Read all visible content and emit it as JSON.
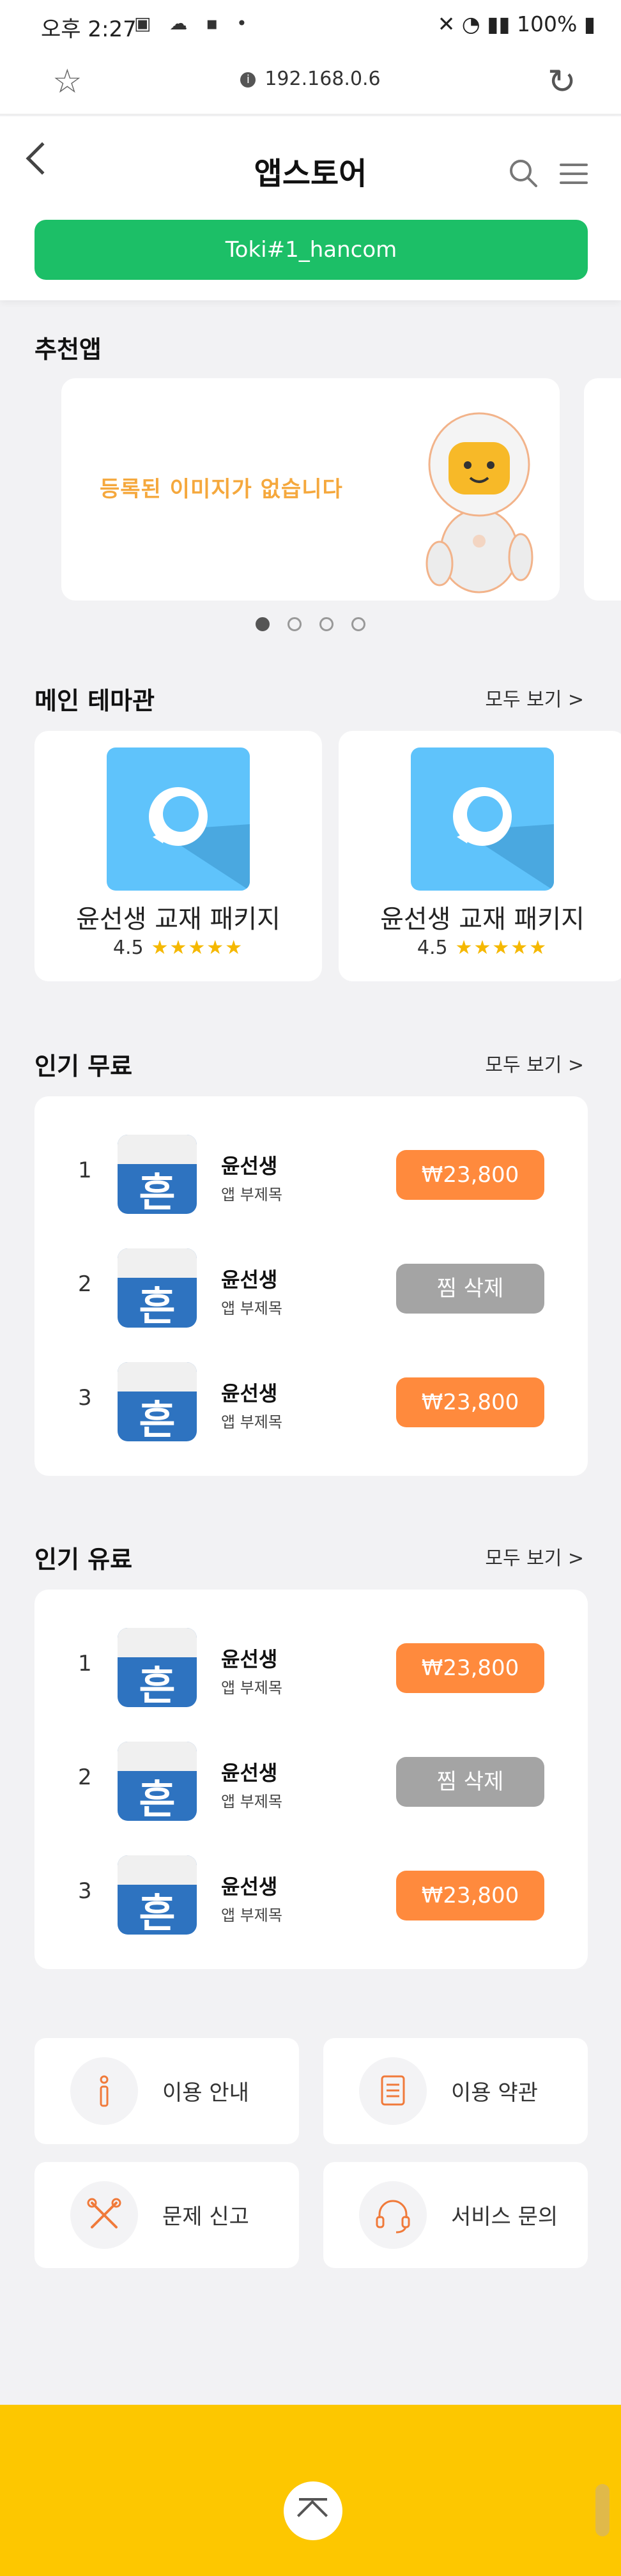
{
  "status_bar": {
    "time": "오후 2:27",
    "battery": "100%"
  },
  "browser": {
    "url": "192.168.0.6"
  },
  "header": {
    "title": "앱스토어",
    "user_button": "Toki#1_hancom"
  },
  "recommend": {
    "title": "추천앱",
    "banner_text": "등록된 이미지가 없습니다",
    "dot_count": 4,
    "active_dot": 1
  },
  "theme": {
    "title": "메인 테마관",
    "see_all": "모두 보기 >",
    "cards": [
      {
        "name": "윤선생 교재 패키지",
        "rating": "4.5",
        "stars": "★★★★★"
      },
      {
        "name": "윤선생 교재 패키지",
        "rating": "4.5",
        "stars": "★★★★★"
      }
    ]
  },
  "popular_free": {
    "title": "인기 무료",
    "see_all": "모두 보기 >",
    "items": [
      {
        "rank": "1",
        "name": "윤선생",
        "sub": "앱 부제목",
        "action": "₩23,800"
      },
      {
        "rank": "2",
        "name": "윤선생",
        "sub": "앱 부제목",
        "action": "찜 삭제"
      },
      {
        "rank": "3",
        "name": "윤선생",
        "sub": "앱 부제목",
        "action": "₩23,800"
      }
    ]
  },
  "popular_paid": {
    "title": "인기 유료",
    "see_all": "모두 보기 >",
    "items": [
      {
        "rank": "1",
        "name": "윤선생",
        "sub": "앱 부제목",
        "action": "₩23,800"
      },
      {
        "rank": "2",
        "name": "윤선생",
        "sub": "앱 부제목",
        "action": "찜 삭제"
      },
      {
        "rank": "3",
        "name": "윤선생",
        "sub": "앱 부제목",
        "action": "₩23,800"
      }
    ]
  },
  "info_buttons": [
    {
      "label": "이용 안내",
      "icon": "info-icon"
    },
    {
      "label": "이용 약관",
      "icon": "document-icon"
    },
    {
      "label": "문제 신고",
      "icon": "tools-icon"
    },
    {
      "label": "서비스 문의",
      "icon": "headset-icon"
    }
  ],
  "colors": {
    "brand_green": "#1cbf67",
    "price_orange": "#ff8a3d",
    "delete_gray": "#a4a4a4",
    "footer_yellow": "#fdc700"
  }
}
